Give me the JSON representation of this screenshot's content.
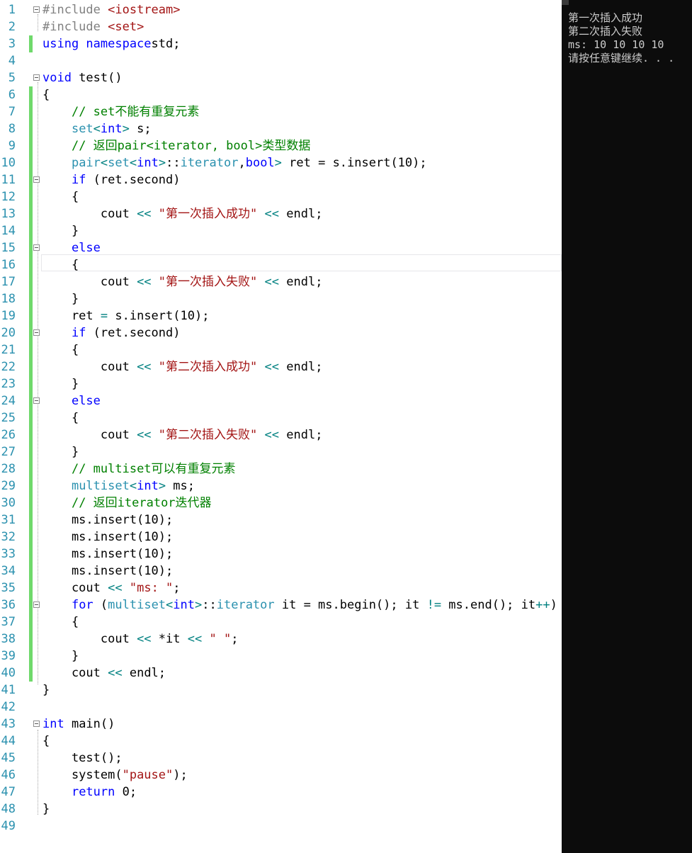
{
  "editor": {
    "lines": [
      {
        "n": "1",
        "fold": true,
        "parts": [
          [
            "pp",
            "#include "
          ],
          [
            "inc",
            "<iostream>"
          ]
        ]
      },
      {
        "n": "2",
        "parts": [
          [
            "pp",
            "#include "
          ],
          [
            "inc",
            "<set>"
          ]
        ]
      },
      {
        "n": "3",
        "changed": true,
        "parts": [
          [
            "kw",
            "using namespace"
          ],
          [
            "",
            "std;"
          ]
        ]
      },
      {
        "n": "4",
        "parts": []
      },
      {
        "n": "5",
        "fold": true,
        "parts": [
          [
            "kw",
            "void"
          ],
          [
            "",
            " test()"
          ]
        ]
      },
      {
        "n": "6",
        "changed": true,
        "parts": [
          [
            "",
            "{"
          ]
        ]
      },
      {
        "n": "7",
        "changed": true,
        "parts": [
          [
            "",
            "    "
          ],
          [
            "cm",
            "// set不能有重复元素"
          ]
        ]
      },
      {
        "n": "8",
        "changed": true,
        "parts": [
          [
            "",
            "    "
          ],
          [
            "ty",
            "set"
          ],
          [
            "op",
            "<"
          ],
          [
            "kw",
            "int"
          ],
          [
            "op",
            ">"
          ],
          [
            "",
            " s;"
          ]
        ]
      },
      {
        "n": "9",
        "changed": true,
        "parts": [
          [
            "",
            "    "
          ],
          [
            "cm",
            "// 返回pair<iterator, bool>类型数据"
          ]
        ]
      },
      {
        "n": "10",
        "changed": true,
        "parts": [
          [
            "",
            "    "
          ],
          [
            "ty",
            "pair"
          ],
          [
            "op",
            "<"
          ],
          [
            "ty",
            "set"
          ],
          [
            "op",
            "<"
          ],
          [
            "kw",
            "int"
          ],
          [
            "op",
            ">"
          ],
          [
            "",
            "::"
          ],
          [
            "ty",
            "iterator"
          ],
          [
            "",
            ","
          ],
          [
            "kw",
            "bool"
          ],
          [
            "op",
            ">"
          ],
          [
            "",
            " ret = s.insert(10);"
          ]
        ]
      },
      {
        "n": "11",
        "changed": true,
        "fold": true,
        "parts": [
          [
            "",
            "    "
          ],
          [
            "kw",
            "if"
          ],
          [
            "",
            " (ret.second)"
          ]
        ]
      },
      {
        "n": "12",
        "changed": true,
        "parts": [
          [
            "",
            "    {"
          ]
        ]
      },
      {
        "n": "13",
        "changed": true,
        "parts": [
          [
            "",
            "        cout "
          ],
          [
            "op",
            "<<"
          ],
          [
            "",
            " "
          ],
          [
            "str",
            "\"第一次插入成功\""
          ],
          [
            "",
            " "
          ],
          [
            "op",
            "<<"
          ],
          [
            "",
            " endl;"
          ]
        ]
      },
      {
        "n": "14",
        "changed": true,
        "parts": [
          [
            "",
            "    }"
          ]
        ]
      },
      {
        "n": "15",
        "changed": true,
        "fold": true,
        "parts": [
          [
            "",
            "    "
          ],
          [
            "kw",
            "else"
          ]
        ]
      },
      {
        "n": "16",
        "changed": true,
        "parts": [
          [
            "",
            "    {"
          ]
        ]
      },
      {
        "n": "17",
        "changed": true,
        "parts": [
          [
            "",
            "        cout "
          ],
          [
            "op",
            "<<"
          ],
          [
            "",
            " "
          ],
          [
            "str",
            "\"第一次插入失败\""
          ],
          [
            "",
            " "
          ],
          [
            "op",
            "<<"
          ],
          [
            "",
            " endl;"
          ]
        ]
      },
      {
        "n": "18",
        "changed": true,
        "parts": [
          [
            "",
            "    }"
          ]
        ]
      },
      {
        "n": "19",
        "changed": true,
        "parts": [
          [
            "",
            "    ret "
          ],
          [
            "op",
            "="
          ],
          [
            "",
            " s.insert(10);"
          ]
        ]
      },
      {
        "n": "20",
        "changed": true,
        "fold": true,
        "parts": [
          [
            "",
            "    "
          ],
          [
            "kw",
            "if"
          ],
          [
            "",
            " (ret.second)"
          ]
        ]
      },
      {
        "n": "21",
        "changed": true,
        "parts": [
          [
            "",
            "    {"
          ]
        ]
      },
      {
        "n": "22",
        "changed": true,
        "parts": [
          [
            "",
            "        cout "
          ],
          [
            "op",
            "<<"
          ],
          [
            "",
            " "
          ],
          [
            "str",
            "\"第二次插入成功\""
          ],
          [
            "",
            " "
          ],
          [
            "op",
            "<<"
          ],
          [
            "",
            " endl;"
          ]
        ]
      },
      {
        "n": "23",
        "changed": true,
        "parts": [
          [
            "",
            "    }"
          ]
        ]
      },
      {
        "n": "24",
        "changed": true,
        "fold": true,
        "parts": [
          [
            "",
            "    "
          ],
          [
            "kw",
            "else"
          ]
        ]
      },
      {
        "n": "25",
        "changed": true,
        "parts": [
          [
            "",
            "    {"
          ]
        ]
      },
      {
        "n": "26",
        "changed": true,
        "parts": [
          [
            "",
            "        cout "
          ],
          [
            "op",
            "<<"
          ],
          [
            "",
            " "
          ],
          [
            "str",
            "\"第二次插入失败\""
          ],
          [
            "",
            " "
          ],
          [
            "op",
            "<<"
          ],
          [
            "",
            " endl;"
          ]
        ]
      },
      {
        "n": "27",
        "changed": true,
        "parts": [
          [
            "",
            "    }"
          ]
        ]
      },
      {
        "n": "28",
        "changed": true,
        "parts": [
          [
            "",
            "    "
          ],
          [
            "cm",
            "// multiset可以有重复元素"
          ]
        ]
      },
      {
        "n": "29",
        "changed": true,
        "parts": [
          [
            "",
            "    "
          ],
          [
            "ty",
            "multiset"
          ],
          [
            "op",
            "<"
          ],
          [
            "kw",
            "int"
          ],
          [
            "op",
            ">"
          ],
          [
            "",
            " ms;"
          ]
        ]
      },
      {
        "n": "30",
        "changed": true,
        "parts": [
          [
            "",
            "    "
          ],
          [
            "cm",
            "// 返回iterator迭代器"
          ]
        ]
      },
      {
        "n": "31",
        "changed": true,
        "parts": [
          [
            "",
            "    ms.insert(10);"
          ]
        ]
      },
      {
        "n": "32",
        "changed": true,
        "parts": [
          [
            "",
            "    ms.insert(10);"
          ]
        ]
      },
      {
        "n": "33",
        "changed": true,
        "parts": [
          [
            "",
            "    ms.insert(10);"
          ]
        ]
      },
      {
        "n": "34",
        "changed": true,
        "parts": [
          [
            "",
            "    ms.insert(10);"
          ]
        ]
      },
      {
        "n": "35",
        "changed": true,
        "parts": [
          [
            "",
            "    cout "
          ],
          [
            "op",
            "<<"
          ],
          [
            "",
            " "
          ],
          [
            "str",
            "\"ms: \""
          ],
          [
            "",
            ";"
          ]
        ]
      },
      {
        "n": "36",
        "changed": true,
        "fold": true,
        "parts": [
          [
            "",
            "    "
          ],
          [
            "kw",
            "for"
          ],
          [
            "",
            " ("
          ],
          [
            "ty",
            "multiset"
          ],
          [
            "op",
            "<"
          ],
          [
            "kw",
            "int"
          ],
          [
            "op",
            ">"
          ],
          [
            "",
            "::"
          ],
          [
            "ty",
            "iterator"
          ],
          [
            "",
            " it = ms.begin(); it "
          ],
          [
            "op",
            "!="
          ],
          [
            "",
            " ms.end(); it"
          ],
          [
            "op",
            "++"
          ],
          [
            "",
            ")"
          ]
        ]
      },
      {
        "n": "37",
        "changed": true,
        "parts": [
          [
            "",
            "    {"
          ]
        ]
      },
      {
        "n": "38",
        "changed": true,
        "parts": [
          [
            "",
            "        cout "
          ],
          [
            "op",
            "<<"
          ],
          [
            "",
            " *it "
          ],
          [
            "op",
            "<<"
          ],
          [
            "",
            " "
          ],
          [
            "str",
            "\" \""
          ],
          [
            "",
            ";"
          ]
        ]
      },
      {
        "n": "39",
        "changed": true,
        "parts": [
          [
            "",
            "    }"
          ]
        ]
      },
      {
        "n": "40",
        "changed": true,
        "parts": [
          [
            "",
            "    cout "
          ],
          [
            "op",
            "<<"
          ],
          [
            "",
            " endl;"
          ]
        ]
      },
      {
        "n": "41",
        "parts": [
          [
            "",
            "}"
          ]
        ]
      },
      {
        "n": "42",
        "parts": []
      },
      {
        "n": "43",
        "fold": true,
        "parts": [
          [
            "kw",
            "int"
          ],
          [
            "",
            " main()"
          ]
        ]
      },
      {
        "n": "44",
        "parts": [
          [
            "",
            "{"
          ]
        ]
      },
      {
        "n": "45",
        "parts": [
          [
            "",
            "    test();"
          ]
        ]
      },
      {
        "n": "46",
        "parts": [
          [
            "",
            "    system("
          ],
          [
            "str",
            "\"pause\""
          ],
          [
            "",
            ");"
          ]
        ]
      },
      {
        "n": "47",
        "parts": [
          [
            "",
            "    "
          ],
          [
            "kw",
            "return"
          ],
          [
            "",
            " 0;"
          ]
        ]
      },
      {
        "n": "48",
        "parts": [
          [
            "",
            "}"
          ]
        ]
      },
      {
        "n": "49",
        "parts": []
      }
    ]
  },
  "console": {
    "lines": [
      "第一次插入成功",
      "第二次插入失败",
      "ms: 10 10 10 10",
      "请按任意键继续. . ."
    ]
  }
}
